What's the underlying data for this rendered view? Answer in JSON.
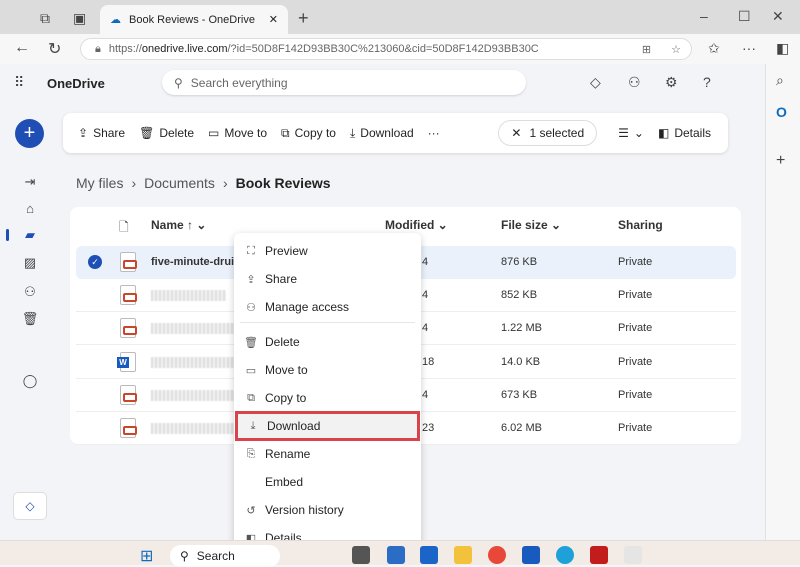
{
  "browser": {
    "tab_title": "Book Reviews - OneDrive",
    "url_prefix": "https://",
    "url_domain": "onedrive.live.com",
    "url_rest": "/?id=50D8F142D93BB30C%213060&cid=50D8F142D93BB30C"
  },
  "app": {
    "name": "OneDrive",
    "search_placeholder": "Search everything"
  },
  "toolbar": {
    "share": "Share",
    "delete": "Delete",
    "move_to": "Move to",
    "copy_to": "Copy to",
    "download": "Download",
    "more": "···",
    "selected": "1 selected",
    "details": "Details"
  },
  "breadcrumb": [
    "My files",
    "Documents",
    "Book Reviews"
  ],
  "table": {
    "headers": {
      "name": "Name ↑",
      "modified": "Modified",
      "size": "File size",
      "sharing": "Sharing"
    },
    "rows": [
      {
        "name": "five-minute-druid",
        "type": "pdf",
        "modified": "4",
        "size": "876 KB",
        "sharing": "Private",
        "selected": true
      },
      {
        "name": "",
        "type": "pdf",
        "modified": "4",
        "size": "852 KB",
        "sharing": "Private"
      },
      {
        "name": "",
        "type": "pdf",
        "modified": "4",
        "size": "1.22 MB",
        "sharing": "Private"
      },
      {
        "name": "",
        "type": "word",
        "modified": "18",
        "size": "14.0 KB",
        "sharing": "Private"
      },
      {
        "name": "",
        "type": "pdf",
        "modified": "4",
        "size": "673 KB",
        "sharing": "Private"
      },
      {
        "name": "",
        "type": "pdf",
        "modified": "23",
        "size": "6.02 MB",
        "sharing": "Private"
      }
    ]
  },
  "context_menu": [
    {
      "label": "Preview",
      "icon": "preview-icon"
    },
    {
      "label": "Share",
      "icon": "share-icon"
    },
    {
      "label": "Manage access",
      "icon": "manage-access-icon"
    },
    {
      "label": "Delete",
      "icon": "delete-icon"
    },
    {
      "label": "Move to",
      "icon": "move-icon"
    },
    {
      "label": "Copy to",
      "icon": "copy-icon"
    },
    {
      "label": "Download",
      "icon": "download-icon",
      "highlighted": true
    },
    {
      "label": "Rename",
      "icon": "rename-icon"
    },
    {
      "label": "Embed",
      "icon": "embed-icon"
    },
    {
      "label": "Version history",
      "icon": "history-icon"
    },
    {
      "label": "Details",
      "icon": "details-icon"
    }
  ],
  "taskbar": {
    "search": "Search"
  },
  "colors": {
    "accent": "#1f4fb5",
    "highlight_border": "#d9434a",
    "selected_row": "#eaf1fb"
  }
}
